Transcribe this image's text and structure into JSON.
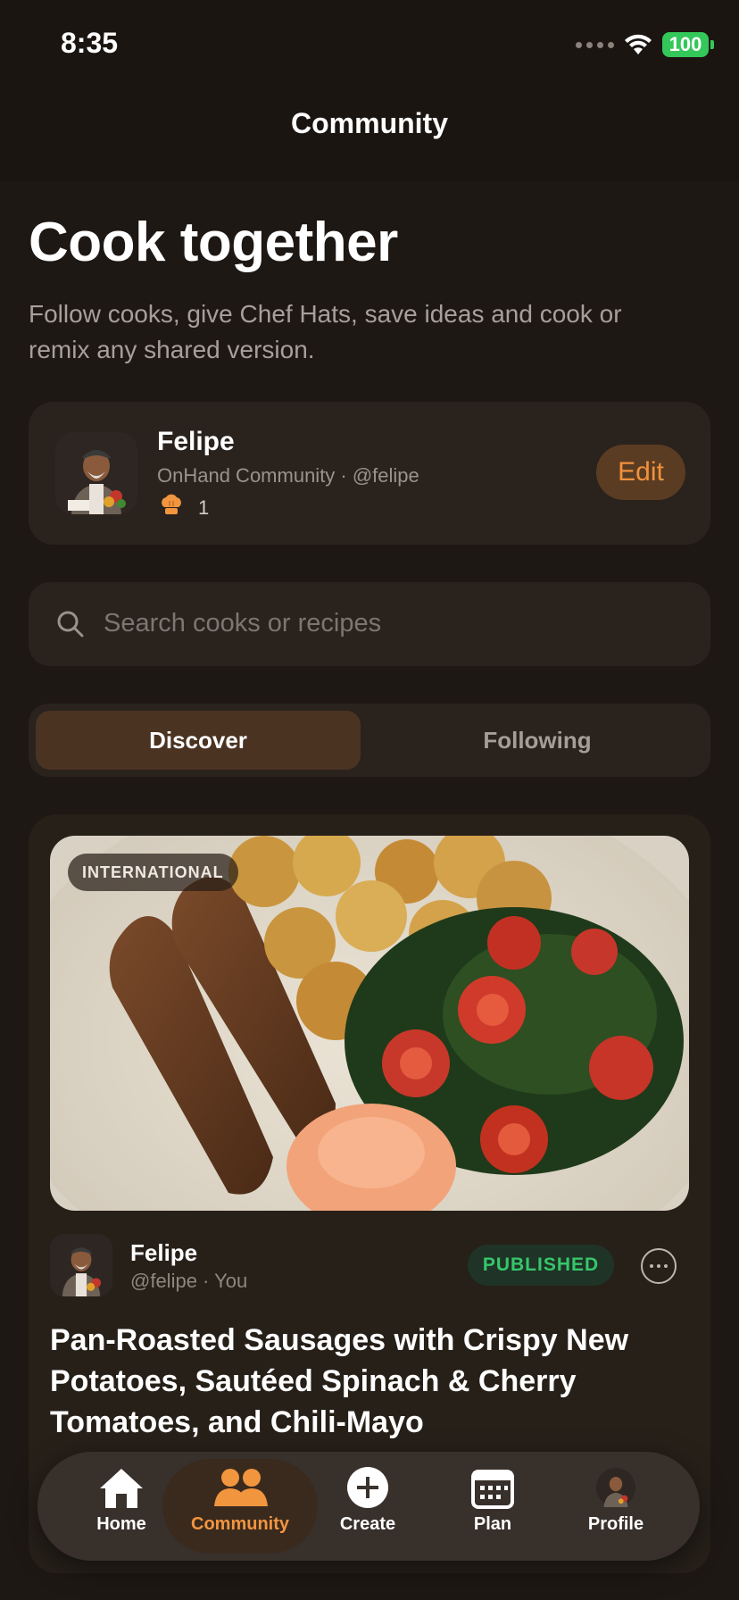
{
  "status_bar": {
    "time": "8:35",
    "battery": "100"
  },
  "nav": {
    "title": "Community"
  },
  "hero": {
    "title": "Cook together",
    "subtitle": "Follow cooks, give Chef Hats, save ideas and cook or remix any shared version."
  },
  "profile": {
    "name": "Felipe",
    "handle": "OnHand Community · @felipe",
    "chef_hats": "1",
    "edit_label": "Edit"
  },
  "search": {
    "placeholder": "Search cooks or recipes"
  },
  "segments": {
    "active": "Discover",
    "inactive": "Following"
  },
  "recipe": {
    "category": "INTERNATIONAL",
    "author_name": "Felipe",
    "author_handle": "@felipe · You",
    "status": "PUBLISHED",
    "title": "Pan-Roasted Sausages with Crispy New Potatoes, Sautéed Spinach & Cherry Tomatoes, and Chili-Mayo"
  },
  "tab_bar": {
    "items": [
      {
        "label": "Home",
        "icon": "house-icon"
      },
      {
        "label": "Community",
        "icon": "people-icon"
      },
      {
        "label": "Create",
        "icon": "plus-circle-icon"
      },
      {
        "label": "Plan",
        "icon": "calendar-icon"
      },
      {
        "label": "Profile",
        "icon": "avatar-icon"
      }
    ],
    "active_index": 1
  },
  "colors": {
    "accent": "#f2953f",
    "background": "#1e1814",
    "card": "#2a221d",
    "published_green": "#35c76a"
  }
}
